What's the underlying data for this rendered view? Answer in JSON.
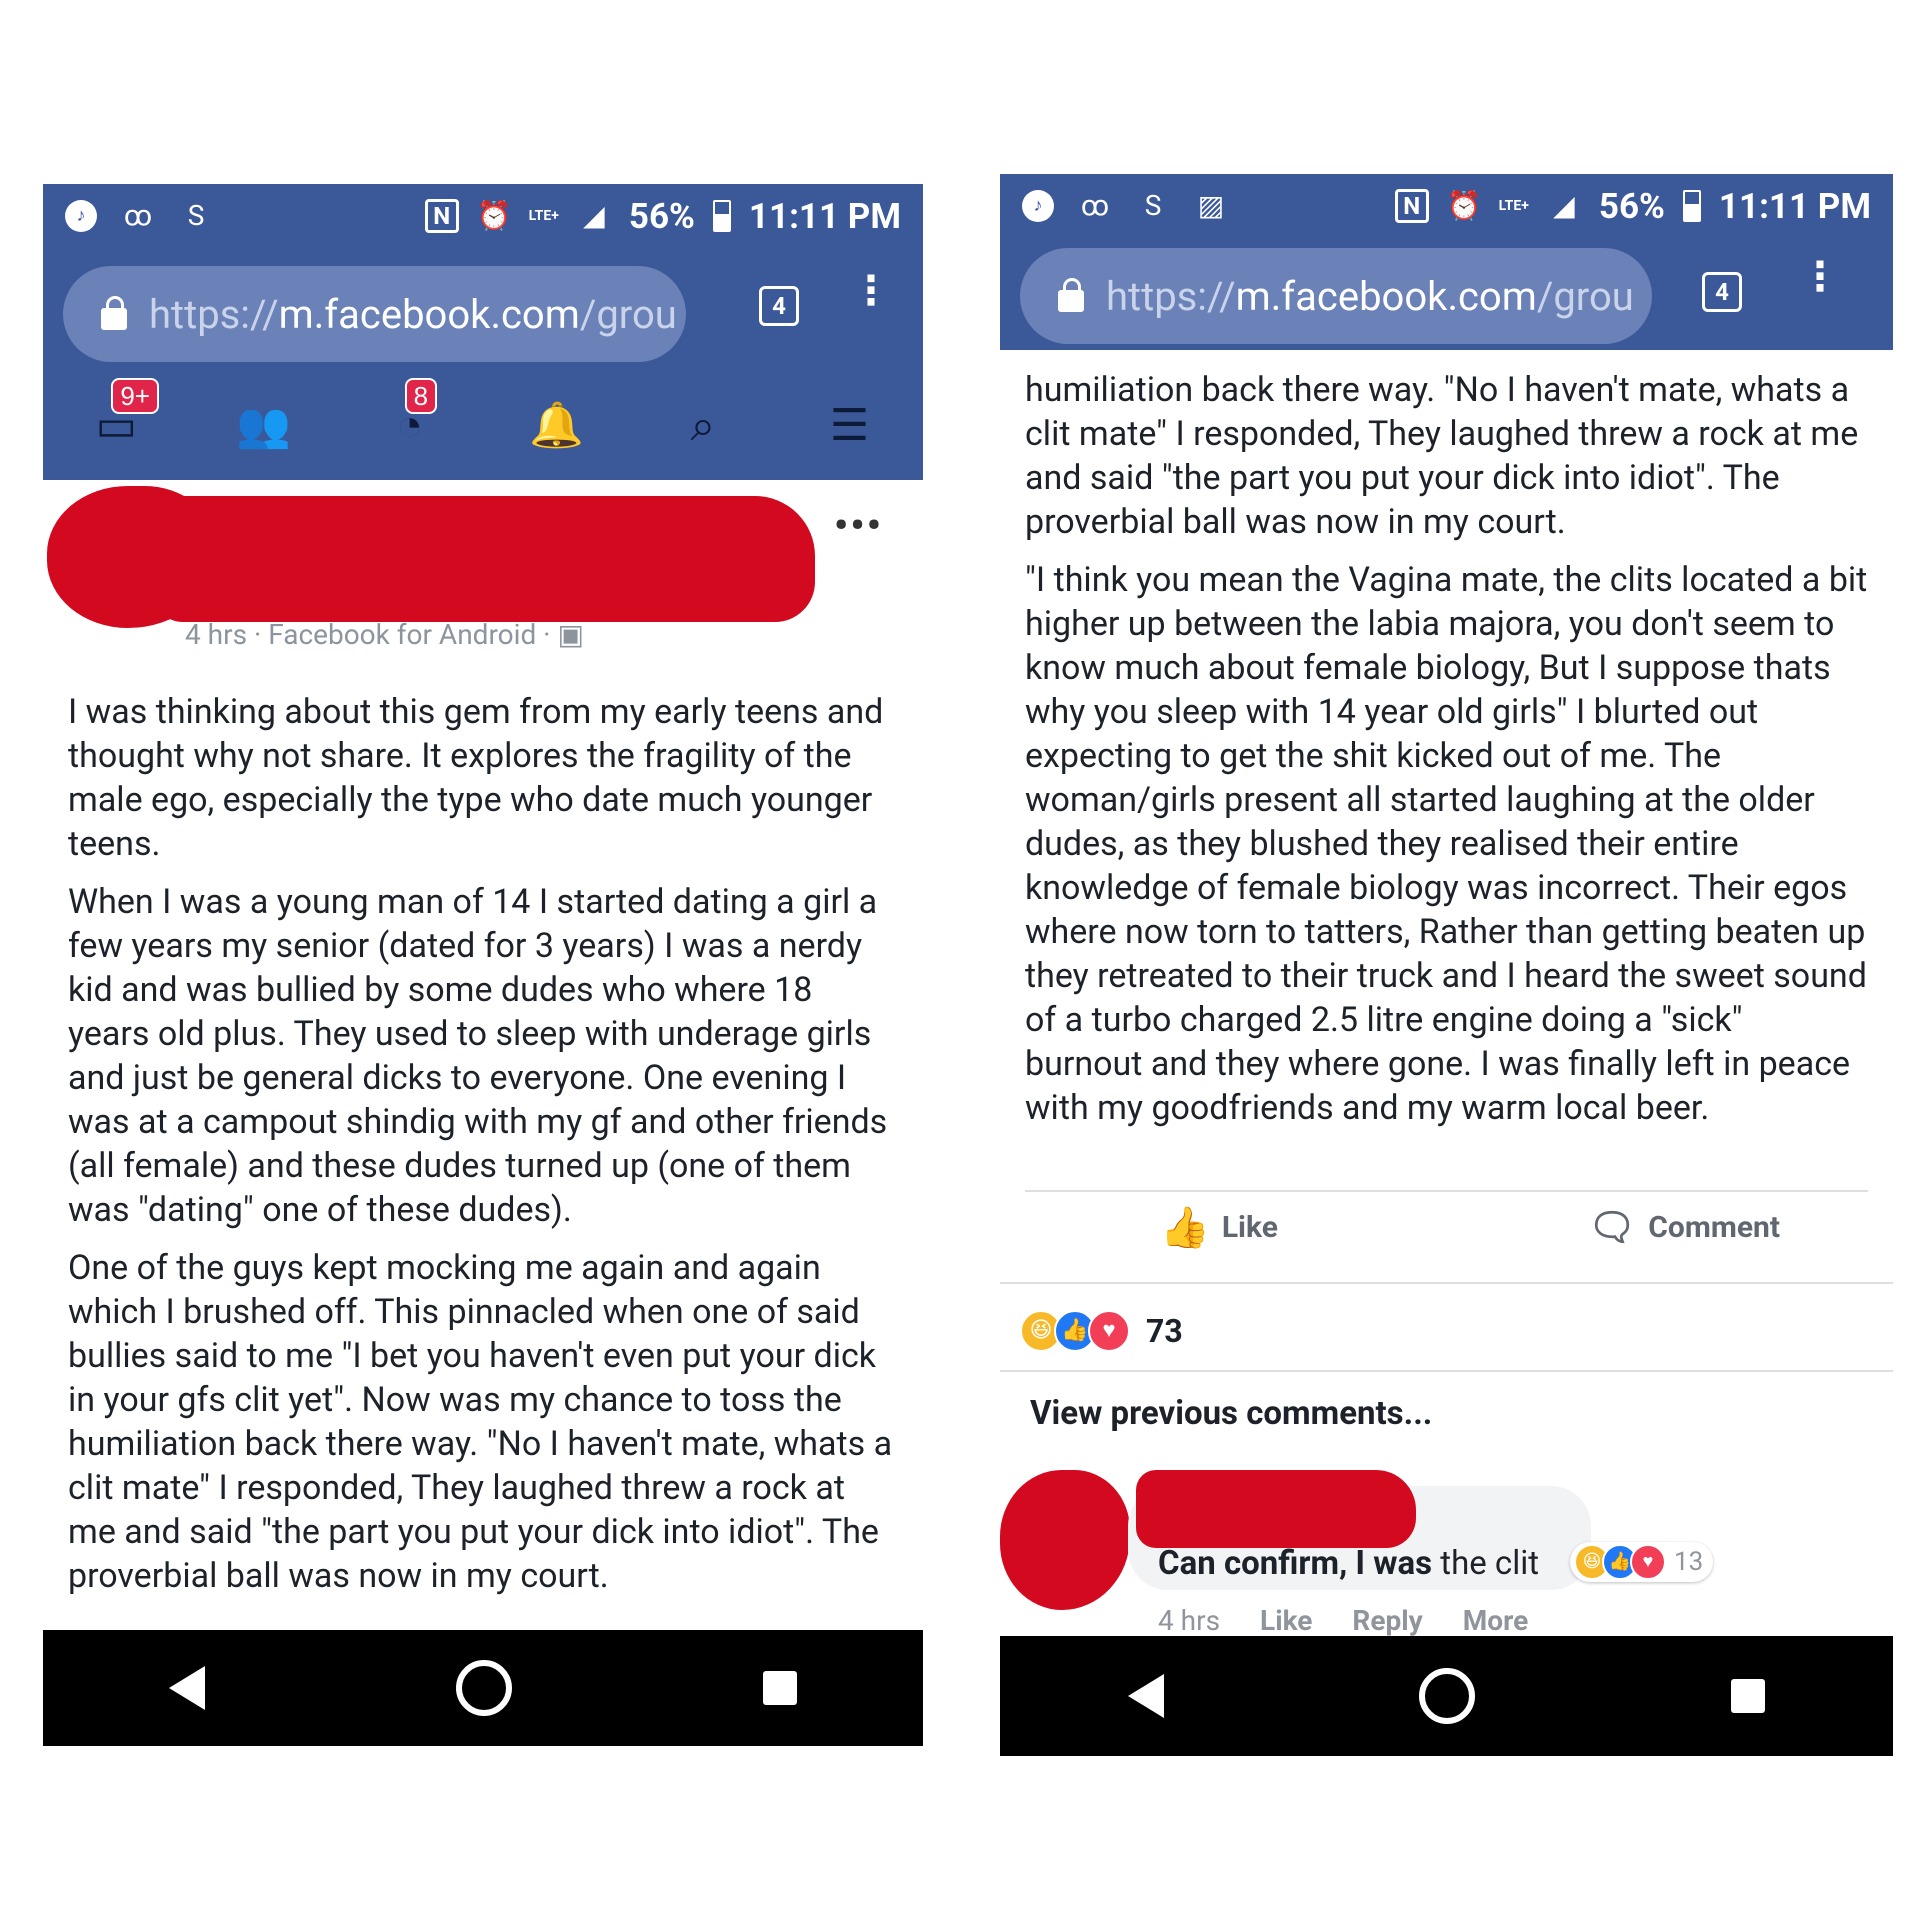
{
  "status_bar": {
    "battery": "56%",
    "time": "11:11 PM",
    "network": "LTE+"
  },
  "browser": {
    "url_secure": "https://",
    "url_host": "m.facebook.com",
    "url_rest": "/grou",
    "tab_count": "4"
  },
  "fb_nav": {
    "feed_badge": "9+",
    "messenger_badge": "8"
  },
  "post": {
    "meta": "4 hrs · Facebook for Android ·",
    "paragraphs": [
      "I was thinking about this gem from my early teens and thought why not share. It explores the fragility of the male ego, especially the type who date much younger teens.",
      "When I was a young man of 14 I started dating a girl a few years my senior (dated for 3 years) I was a nerdy kid and was bullied by some dudes who where 18 years old plus. They used to sleep with underage girls and just be general dicks to everyone. One evening I was at a campout shindig with my gf and other friends (all female) and these dudes turned up (one of them was \"dating\" one of these dudes).",
      "One of the guys kept mocking me again and again which I brushed off. This pinnacled when one of said bullies said to me \"I bet you haven't even put your dick in your gfs clit yet\". Now was my chance to toss the humiliation back there way. \"No I haven't mate, whats a clit mate\" I responded, They laughed threw a rock at me and said \"the part you put your dick into idiot\". The proverbial ball was now in my court.",
      "\"I think you mean the Vagina mate, the clits located a bit higher up between the labia majora, you don't seem to know much about female biology, But I suppose thats why you sleep with 14 year old girls\" I blurted out expecting to get the shit kicked out of me. The woman/girls present all started laughing at the older dudes, as they blushed they realised their entire knowledge of female biology was incorrect. Their egos where now torn to tatters, Rather than getting beaten up they retreated to their truck and I heard the sweet sound of a turbo charged 2.5 litre engine doing a \"sick\" burnout and they where gone. I was finally left in peace with my goodfriends and my warm local beer."
    ],
    "right_first_paragraph": "humiliation back there way. \"No I haven't mate, whats a clit mate\" I responded, They laughed threw a rock at me and said \"the part you put your dick into idiot\". The proverbial ball was now in my court."
  },
  "actions": {
    "like": "Like",
    "comment": "Comment"
  },
  "reactions": {
    "count": "73"
  },
  "comments": {
    "view_previous": "View previous comments...",
    "first": {
      "text_bold": "Can confirm, I was",
      "text_rest": " the clit",
      "reaction_count": "13",
      "time": "4 hrs",
      "like": "Like",
      "reply": "Reply",
      "more": "More"
    }
  },
  "colors": {
    "fb_blue": "#3b5998",
    "redaction": "#d2091f"
  }
}
